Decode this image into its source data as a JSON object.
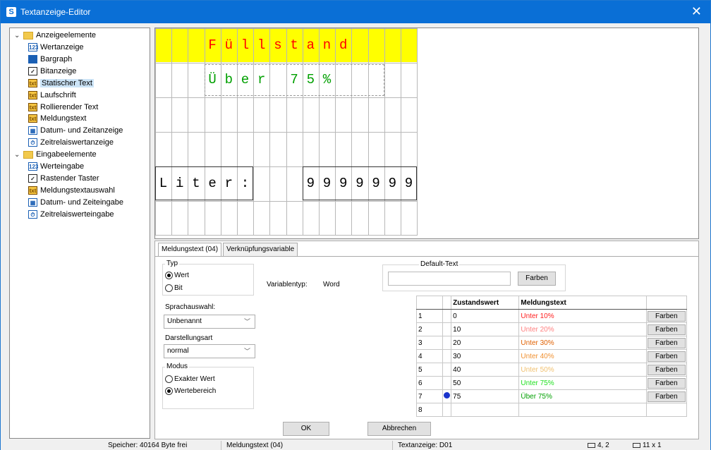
{
  "window": {
    "title": "Textanzeige-Editor",
    "app_icon": "S",
    "close_glyph": "✕"
  },
  "tree": {
    "groups": [
      {
        "label": "Anzeigeelemente",
        "items": [
          {
            "label": "Wertanzeige",
            "icon": "123"
          },
          {
            "label": "Bargraph",
            "icon": "bar"
          },
          {
            "label": "Bitanzeige",
            "icon": "check"
          },
          {
            "label": "Statischer Text",
            "icon": "txt",
            "selected": true
          },
          {
            "label": "Laufschrift",
            "icon": "txt"
          },
          {
            "label": "Rollierender Text",
            "icon": "txt"
          },
          {
            "label": "Meldungstext",
            "icon": "txt"
          },
          {
            "label": "Datum- und Zeitanzeige",
            "icon": "cal"
          },
          {
            "label": "Zeitrelaiswertanzeige",
            "icon": "timer"
          }
        ]
      },
      {
        "label": "Eingabeelemente",
        "items": [
          {
            "label": "Werteingabe",
            "icon": "123"
          },
          {
            "label": "Rastender Taster",
            "icon": "check"
          },
          {
            "label": "Meldungstextauswahl",
            "icon": "txt"
          },
          {
            "label": "Datum- und Zeiteingabe",
            "icon": "cal"
          },
          {
            "label": "Zeitrelaiswerteingabe",
            "icon": "timer"
          }
        ]
      }
    ]
  },
  "display": {
    "row1": [
      "F",
      "ü",
      "l",
      "l",
      "s",
      "t",
      "a",
      "n",
      "d"
    ],
    "row2": [
      "Ü",
      "b",
      "e",
      "r",
      " ",
      "7",
      "5",
      "%"
    ],
    "row5_label": [
      "L",
      "i",
      "t",
      "e",
      "r",
      ":"
    ],
    "row5_value": [
      "9",
      "9",
      "9",
      "9",
      "9",
      "9",
      "9"
    ],
    "colors": {
      "red": "#ff0000",
      "green": "#00a000",
      "black": "#000000",
      "yellow": "#ffff00"
    }
  },
  "panel": {
    "tabs": [
      "Meldungstext (04)",
      "Verknüpfungsvariable"
    ],
    "typ": {
      "title": "Typ",
      "options": [
        "Wert",
        "Bit"
      ],
      "selected": "Wert"
    },
    "sprachauswahl": {
      "label": "Sprachauswahl:",
      "value": "Unbenannt"
    },
    "darstellungsart": {
      "label": "Darstellungsart",
      "value": "normal"
    },
    "modus": {
      "title": "Modus",
      "options": [
        "Exakter Wert",
        "Wertebereich"
      ],
      "selected": "Wertebereich"
    },
    "variablentyp": {
      "label": "Variablentyp:",
      "value": "Word"
    },
    "default_text": {
      "title": "Default-Text",
      "value": "",
      "button": "Farben"
    },
    "table": {
      "headers": [
        "Zustandswert",
        "Meldungstext"
      ],
      "rows": [
        {
          "n": "1",
          "value": "0",
          "text": "Unter 10%",
          "color": "#ff2020",
          "button": "Farben"
        },
        {
          "n": "2",
          "value": "10",
          "text": "Unter 20%",
          "color": "#ff8080",
          "button": "Farben"
        },
        {
          "n": "3",
          "value": "20",
          "text": "Unter 30%",
          "color": "#e06000",
          "button": "Farben"
        },
        {
          "n": "4",
          "value": "30",
          "text": "Unter 40%",
          "color": "#f09030",
          "button": "Farben"
        },
        {
          "n": "5",
          "value": "40",
          "text": "Unter 50%",
          "color": "#f0c070",
          "button": "Farben"
        },
        {
          "n": "6",
          "value": "50",
          "text": "Unter 75%",
          "color": "#20e020",
          "button": "Farben"
        },
        {
          "n": "7",
          "value": "75",
          "text": "Über 75%",
          "color": "#00a000",
          "button": "Farben",
          "marked": true
        },
        {
          "n": "8",
          "value": "",
          "text": "",
          "color": "#000000",
          "button": ""
        }
      ]
    }
  },
  "buttons": {
    "ok": "OK",
    "cancel": "Abbrechen"
  },
  "status": {
    "memory": "Speicher: 40164 Byte frei",
    "element": "Meldungstext (04)",
    "display": "Textanzeige: D01",
    "pos": "4, 2",
    "size": "11 x 1"
  }
}
